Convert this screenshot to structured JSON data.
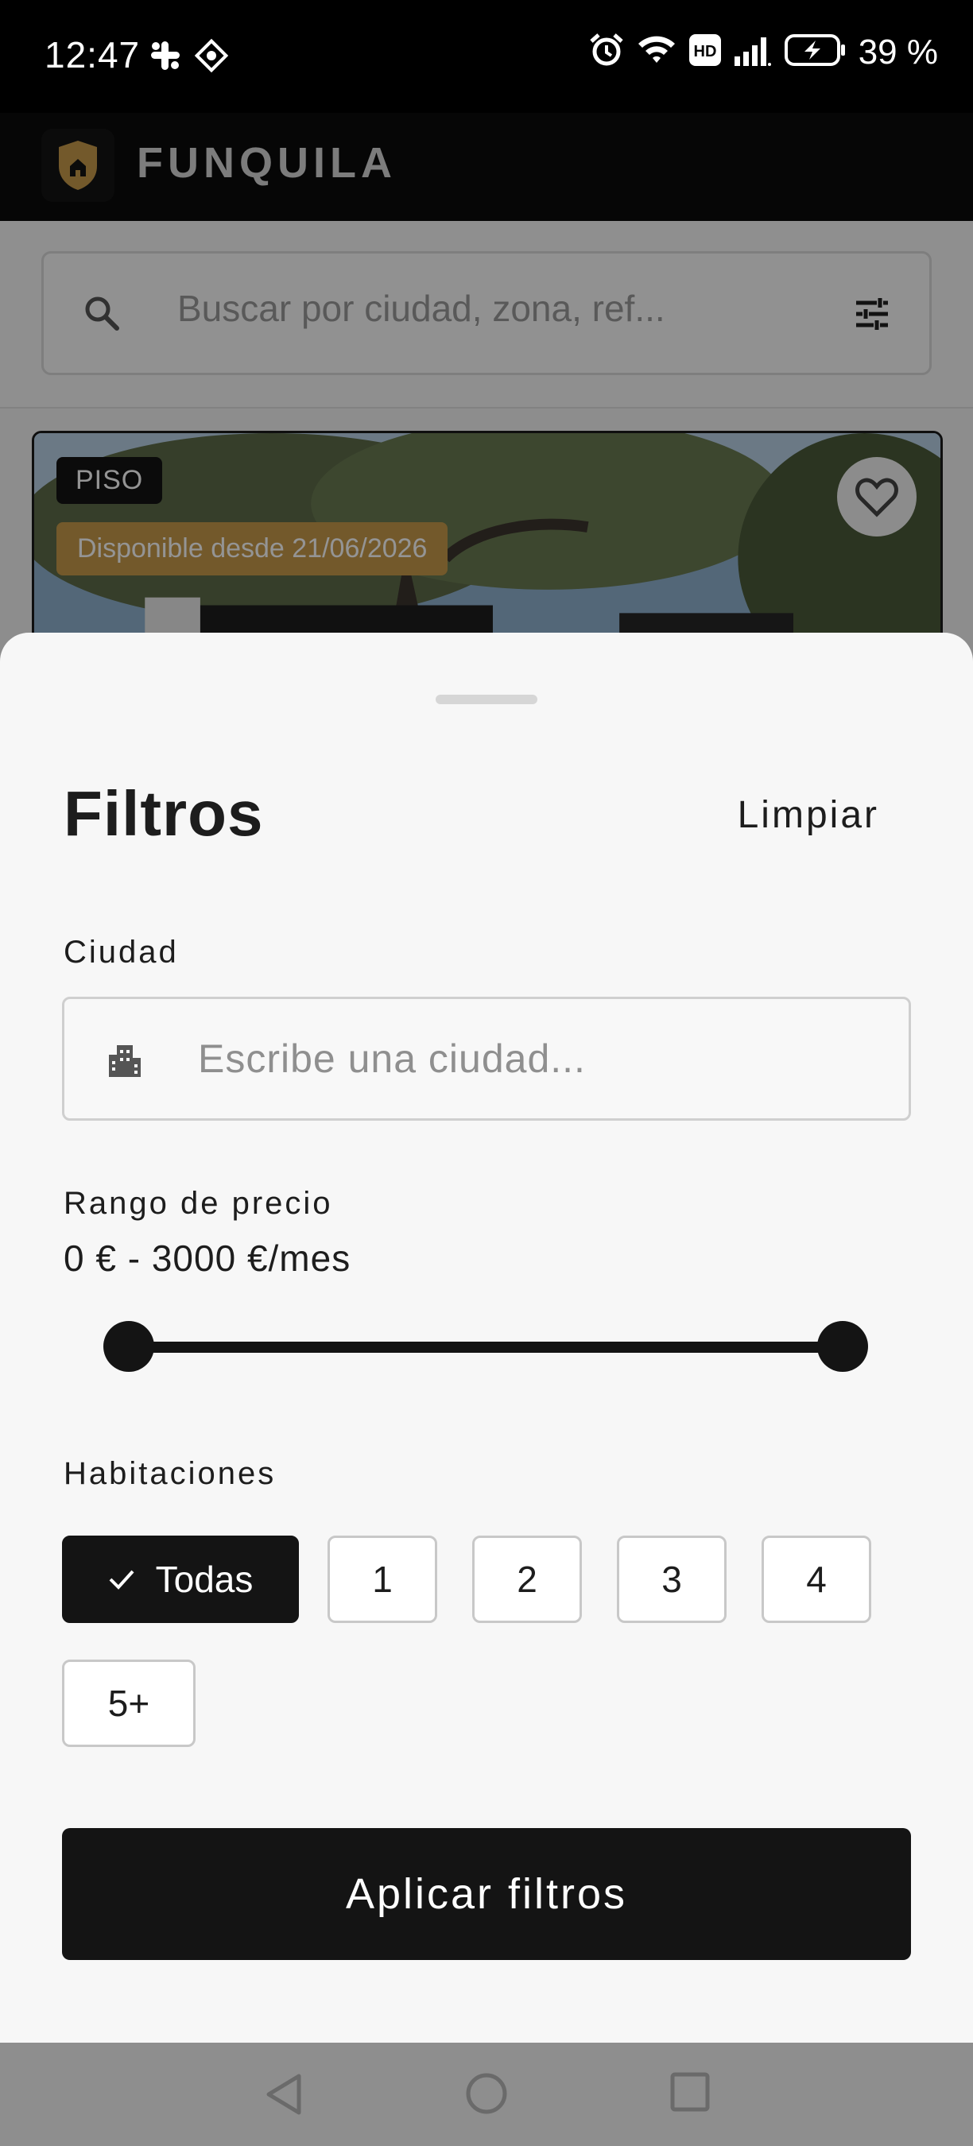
{
  "status_bar": {
    "time": "12:47",
    "battery": "39 %",
    "hd_label": "HD"
  },
  "app": {
    "name": "FUNQUILA"
  },
  "search": {
    "placeholder": "Buscar por ciudad, zona, ref..."
  },
  "listing": {
    "type_badge": "PISO",
    "availability": "Disponible desde 21/06/2026"
  },
  "filters": {
    "title": "Filtros",
    "clear_label": "Limpiar",
    "city": {
      "label": "Ciudad",
      "placeholder": "Escribe una ciudad..."
    },
    "price": {
      "label": "Rango de precio",
      "value_text": "0 € - 3000 €/mes",
      "min": 0,
      "max": 3000,
      "selected_min": 0,
      "selected_max": 3000
    },
    "rooms": {
      "label": "Habitaciones",
      "options": [
        "Todas",
        "1",
        "2",
        "3",
        "4",
        "5+"
      ],
      "selected": "Todas"
    },
    "apply_label": "Aplicar filtros"
  },
  "colors": {
    "accent": "#141414",
    "badge_gold": "#c79a4a",
    "sheet_bg": "#f7f7f7"
  },
  "icons": [
    "slack-icon",
    "app-icon",
    "alarm-icon",
    "wifi-icon",
    "hd-icon",
    "signal-icon",
    "battery-icon",
    "search-icon",
    "tune-icon",
    "heart-icon",
    "building-icon",
    "check-icon",
    "back-icon",
    "home-icon",
    "recents-icon"
  ]
}
